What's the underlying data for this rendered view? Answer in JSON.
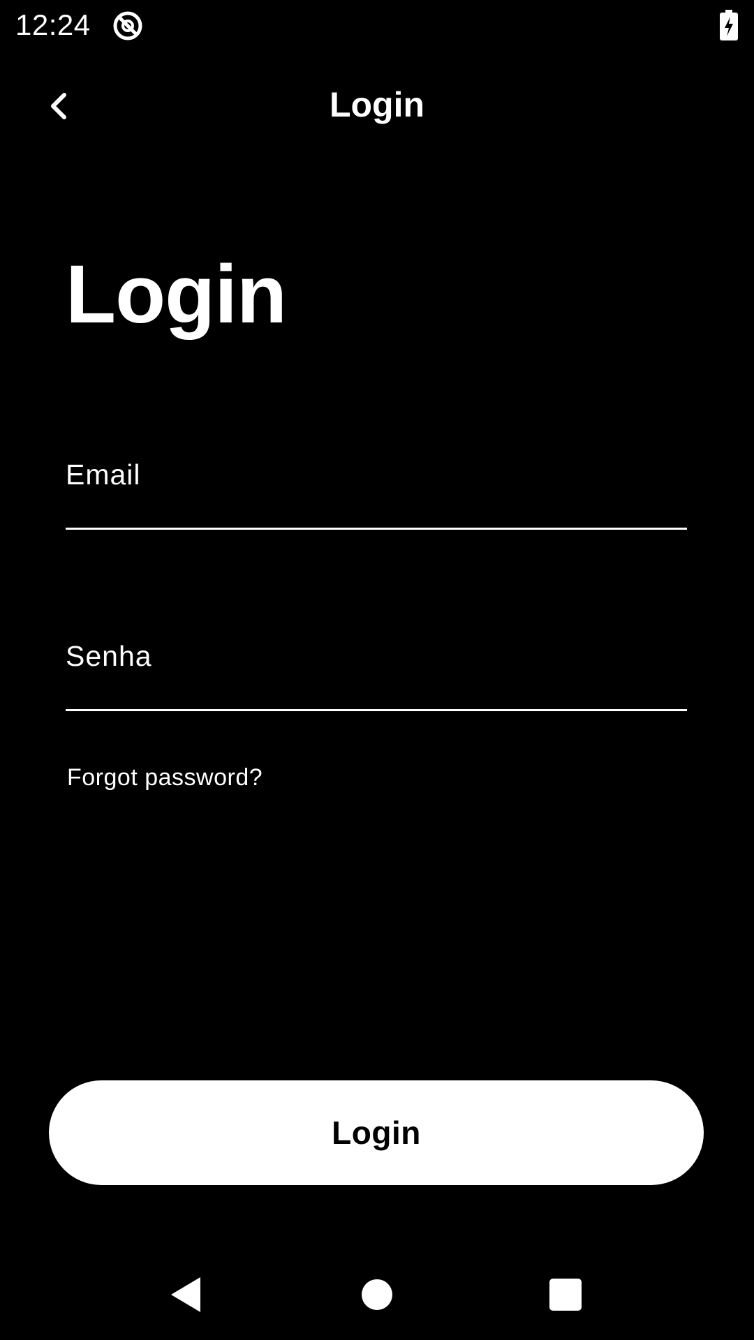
{
  "status_bar": {
    "time": "12:24",
    "app_icon": "circle-slash-icon",
    "battery_icon": "battery-charging-icon"
  },
  "app_bar": {
    "back_icon": "chevron-left-icon",
    "title": "Login"
  },
  "heading": "Login",
  "form": {
    "email": {
      "placeholder": "Email",
      "value": ""
    },
    "password": {
      "placeholder": "Senha",
      "value": ""
    },
    "forgot_password": "Forgot password?",
    "submit_label": "Login"
  },
  "nav_bar": {
    "back_icon": "triangle-back-icon",
    "home_icon": "circle-home-icon",
    "recents_icon": "square-recents-icon"
  },
  "colors": {
    "background": "#000000",
    "foreground": "#ffffff",
    "button_text": "#000000"
  }
}
